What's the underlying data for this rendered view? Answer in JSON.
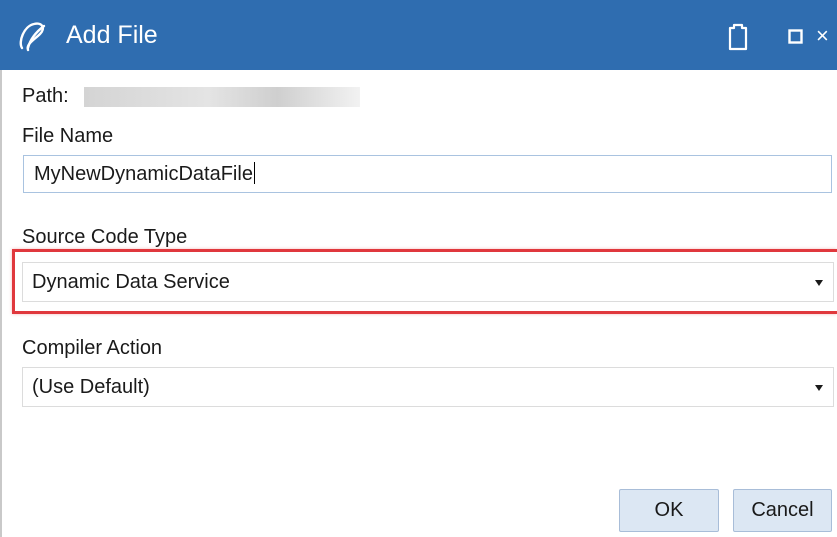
{
  "dialog": {
    "title": "Add File",
    "close_glyph": "×",
    "icons": {
      "logo": "swirl-logo-icon",
      "clipboard": "clipboard-icon",
      "maximize": "maximize-icon",
      "close": "close-icon"
    },
    "colors": {
      "titlebar": "#2f6db0",
      "highlight": "#e0383d",
      "button_bg": "#dce7f3"
    }
  },
  "path": {
    "label": "Path:",
    "value": ""
  },
  "file_name": {
    "label": "File Name",
    "value": "MyNewDynamicDataFile"
  },
  "source_code_type": {
    "label": "Source Code Type",
    "selected": "Dynamic Data Service"
  },
  "compiler_action": {
    "label": "Compiler Action",
    "selected": "(Use Default)"
  },
  "buttons": {
    "ok": "OK",
    "cancel": "Cancel"
  }
}
